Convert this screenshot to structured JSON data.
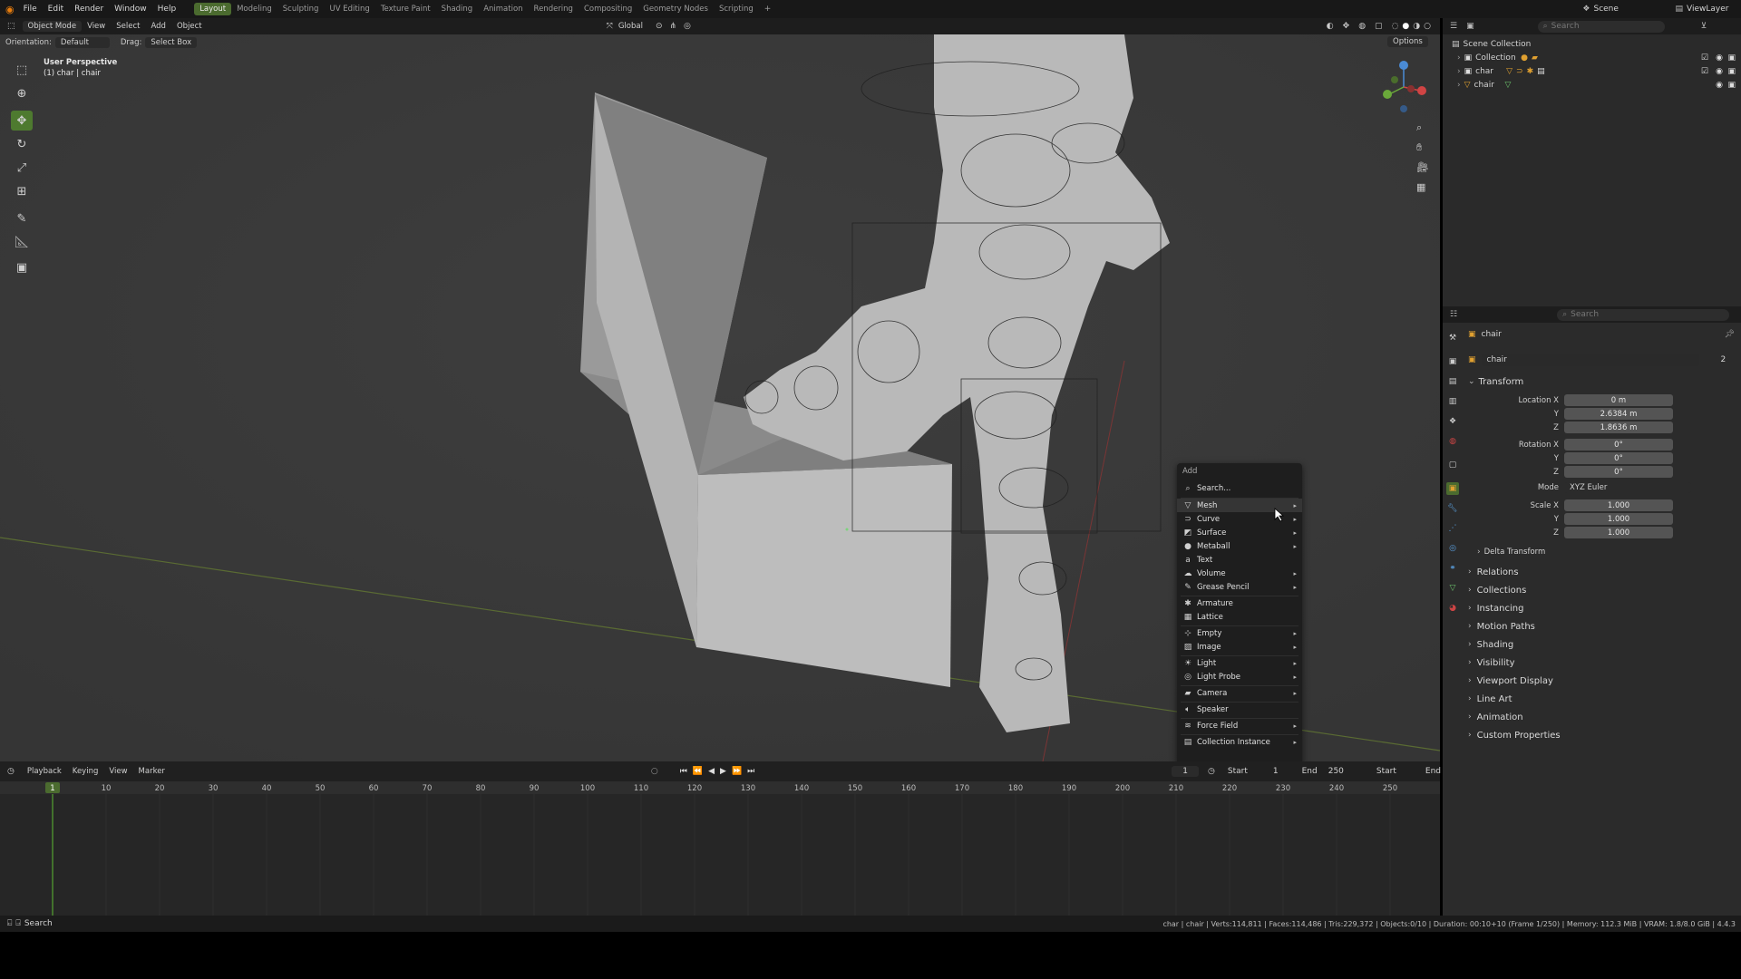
{
  "menus": [
    "File",
    "Edit",
    "Render",
    "Window",
    "Help"
  ],
  "workspaces": [
    "Layout",
    "Modeling",
    "Sculpting",
    "UV Editing",
    "Texture Paint",
    "Shading",
    "Animation",
    "Rendering",
    "Compositing",
    "Geometry Nodes",
    "Scripting"
  ],
  "active_workspace": "Layout",
  "scene_label": "Scene",
  "viewlayer_label": "ViewLayer",
  "header": {
    "mode": "Object Mode",
    "view": "View",
    "select": "Select",
    "add": "Add",
    "object": "Object",
    "transform_space": "Global",
    "orientation_label": "Orientation:",
    "orientation_value": "Default",
    "drag_label": "Drag:",
    "drag_value": "Select Box",
    "options": "Options"
  },
  "viewport": {
    "perspective": "User Perspective",
    "context": "(1) char | chair"
  },
  "outliner": {
    "search_placeholder": "Search",
    "root": "Scene Collection",
    "items": [
      "Collection",
      "char",
      "chair"
    ]
  },
  "properties": {
    "search_placeholder": "Search",
    "object_name": "chair",
    "data_name": "chair",
    "users": "2",
    "transform_title": "Transform",
    "location_label": "Location X",
    "location": [
      "0 m",
      "2.6384 m",
      "1.8636 m"
    ],
    "rotation_label": "Rotation X",
    "rotation": [
      "0°",
      "0°",
      "0°"
    ],
    "mode_label": "Mode",
    "mode_value": "XYZ Euler",
    "scale_label": "Scale X",
    "scale": [
      "1.000",
      "1.000",
      "1.000"
    ],
    "y_label": "Y",
    "z_label": "Z",
    "delta": "Delta Transform",
    "panels": [
      "Relations",
      "Collections",
      "Instancing",
      "Motion Paths",
      "Shading",
      "Visibility",
      "Viewport Display",
      "Line Art",
      "Animation",
      "Custom Properties"
    ]
  },
  "add_menu": {
    "title": "Add",
    "search": "Search...",
    "items": [
      "Mesh",
      "Curve",
      "Surface",
      "Metaball",
      "Text",
      "Volume",
      "Grease Pencil",
      "Armature",
      "Lattice",
      "Empty",
      "Image",
      "Light",
      "Light Probe",
      "Camera",
      "Speaker",
      "Force Field",
      "Collection Instance"
    ]
  },
  "timeline": {
    "playback": "Playback",
    "keying": "Keying",
    "view": "View",
    "marker": "Marker",
    "current_frame": "1",
    "start_label": "Start",
    "start_value": "1",
    "end_label": "End",
    "end_value": "250",
    "start2": "Start",
    "end2": "End",
    "ticks": [
      "1",
      "10",
      "20",
      "30",
      "40",
      "50",
      "60",
      "70",
      "80",
      "90",
      "100",
      "110",
      "120",
      "130",
      "140",
      "150",
      "160",
      "170",
      "180",
      "190",
      "200",
      "210",
      "220",
      "230",
      "240",
      "250"
    ]
  },
  "status": {
    "search": "Search",
    "info": "char | chair | Verts:114,811 | Faces:114,486 | Tris:229,372 | Objects:0/10 | Duration: 00:10+10 (Frame 1/250) | Memory: 112.3 MiB | VRAM: 1.8/8.0 GiB | 4.4.3"
  },
  "colors": {
    "accent_green": "#4b6b2f",
    "viewport_bg": "#3b3b3b",
    "panel_bg": "#2b2b2b",
    "playhead": "#4fa3ff"
  }
}
